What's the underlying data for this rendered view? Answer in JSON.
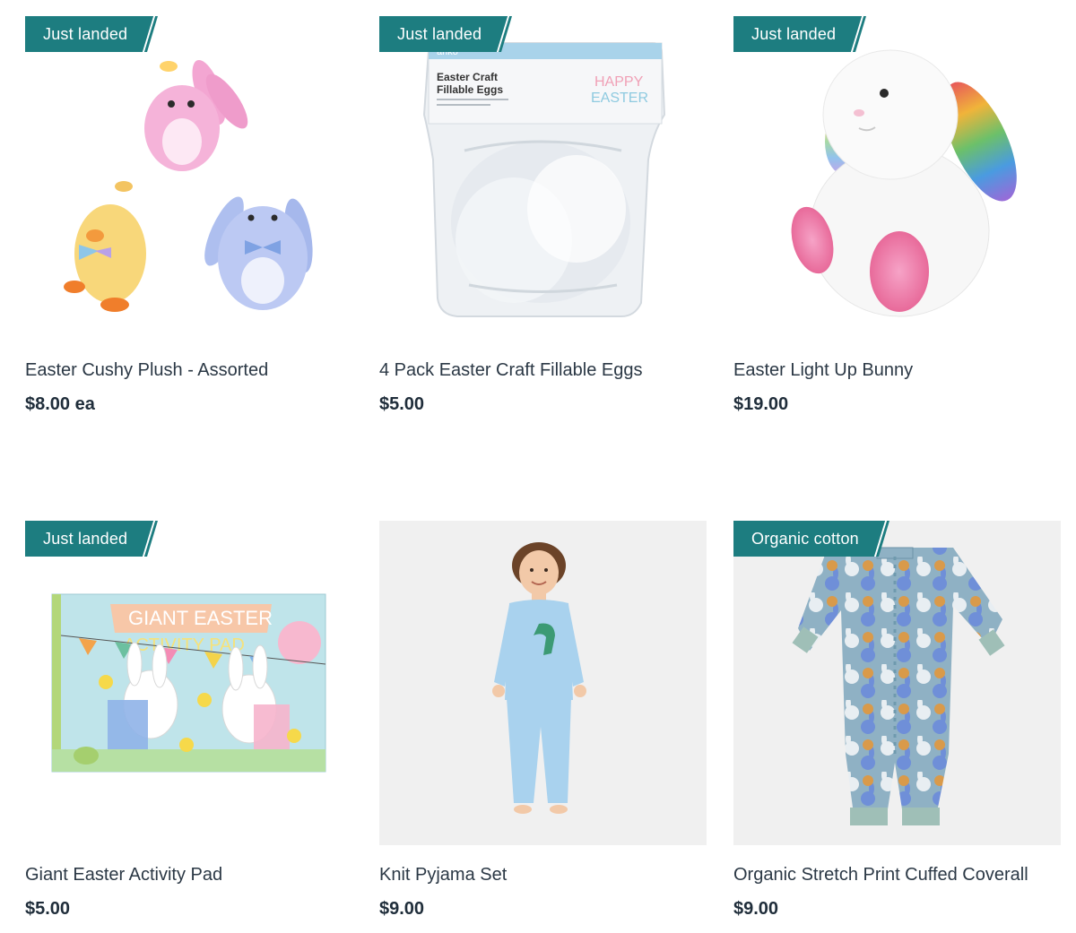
{
  "products": [
    {
      "badge": "Just landed",
      "title": "Easter Cushy Plush - Assorted",
      "price": "$8.00 ea"
    },
    {
      "badge": "Just landed",
      "title": "4 Pack Easter Craft Fillable Eggs",
      "price": "$5.00",
      "package": {
        "brand": "anko",
        "name_line1": "Easter Craft",
        "name_line2": "Fillable Eggs",
        "happy": "HAPPY",
        "easter": "EASTER"
      }
    },
    {
      "badge": "Just landed",
      "title": "Easter Light Up Bunny",
      "price": "$19.00"
    },
    {
      "badge": "Just landed",
      "title": "Giant Easter Activity Pad",
      "price": "$5.00",
      "cover": {
        "line1": "GIANT EASTER",
        "line2": "ACTIVITY PAD"
      }
    },
    {
      "badge": "",
      "title": "Knit Pyjama Set",
      "price": "$9.00"
    },
    {
      "badge": "Organic cotton",
      "title": "Organic Stretch Print Cuffed Coverall",
      "price": "$9.00"
    }
  ],
  "colors": {
    "badge": "#1d7d80",
    "text": "#1f2d3a"
  }
}
